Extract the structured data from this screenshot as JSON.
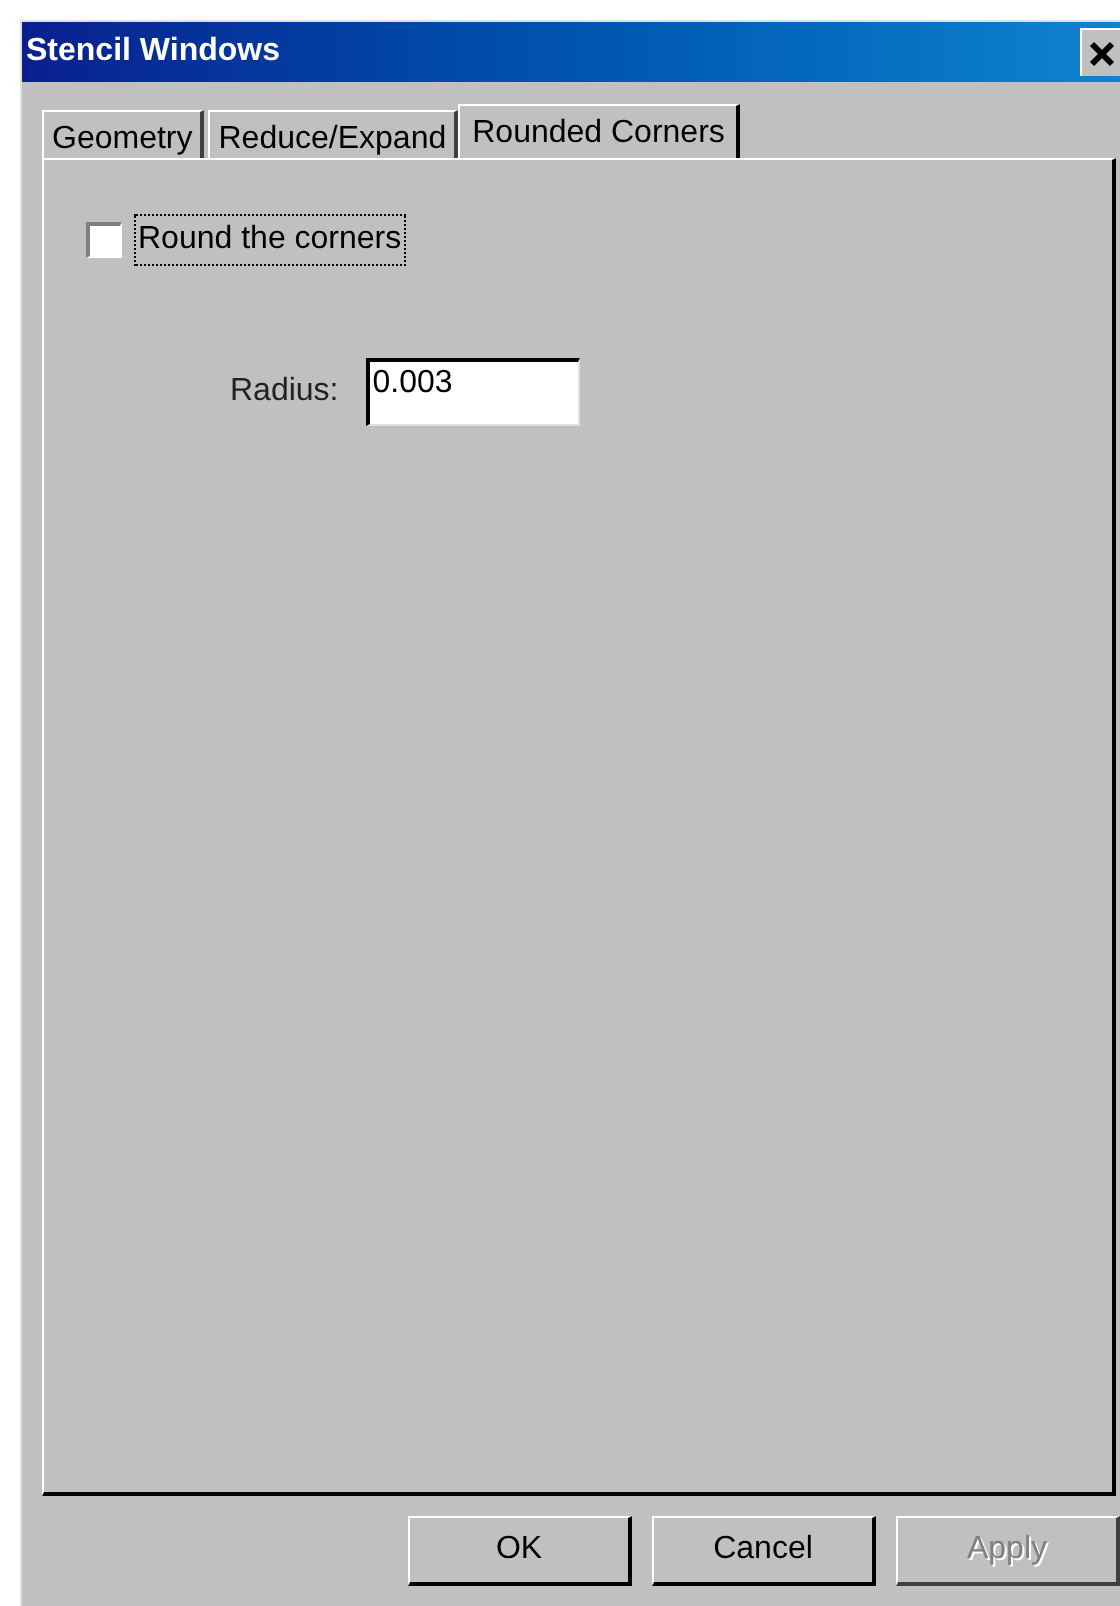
{
  "window": {
    "title": "Stencil Windows"
  },
  "tabs": [
    {
      "label": "Geometry",
      "selected": false
    },
    {
      "label": "Reduce/Expand",
      "selected": false
    },
    {
      "label": "Rounded Corners",
      "selected": true
    }
  ],
  "checkbox": {
    "label": "Round the corners",
    "checked": false
  },
  "radius": {
    "label": "Radius:",
    "value": "0.003"
  },
  "buttons": [
    {
      "label": "OK",
      "disabled": false
    },
    {
      "label": "Cancel",
      "disabled": false
    },
    {
      "label": "Apply",
      "disabled": true
    }
  ]
}
